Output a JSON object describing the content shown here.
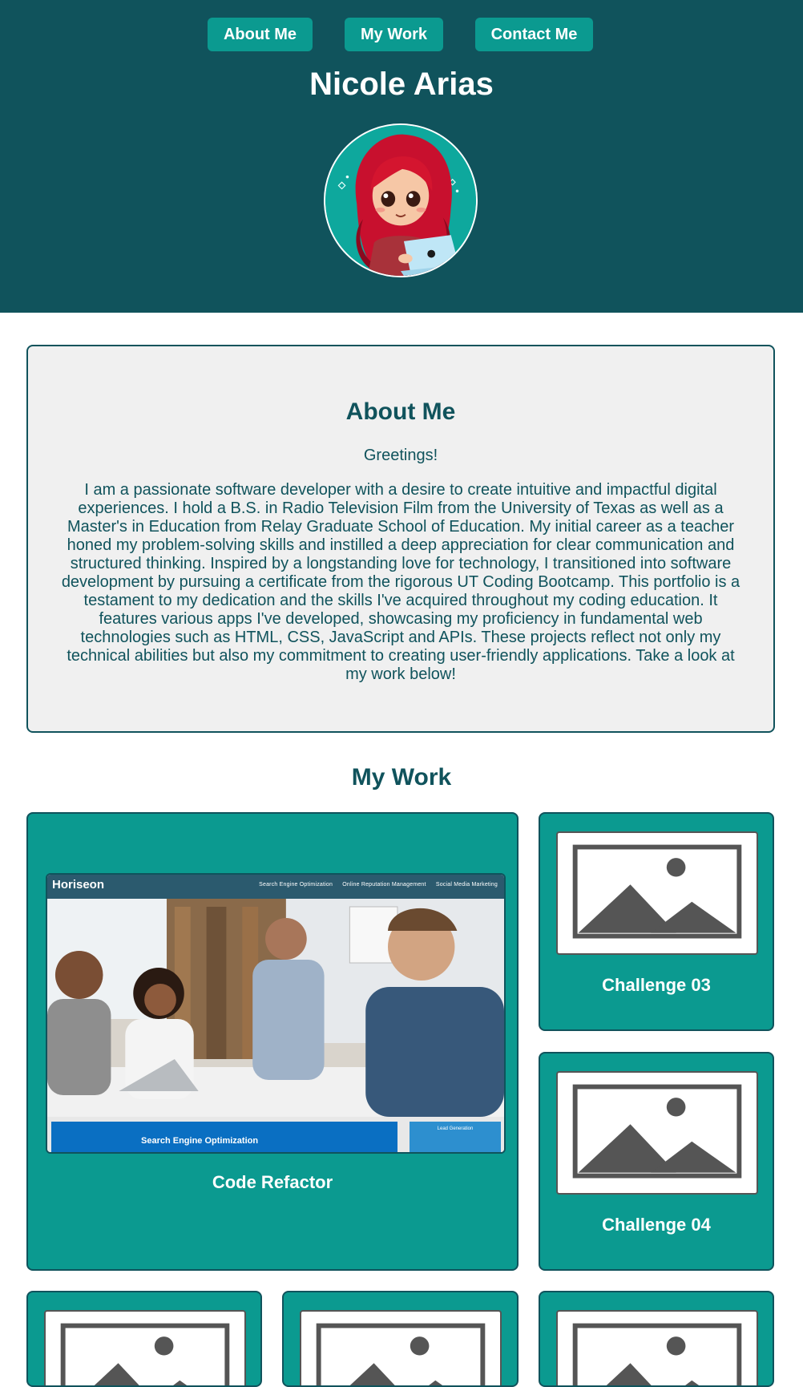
{
  "nav": {
    "about_label": "About Me",
    "work_label": "My Work",
    "contact_label": "Contact Me"
  },
  "header": {
    "title": "Nicole Arias",
    "avatar_icon": "cartoon-avatar-red-hair-laptop"
  },
  "about": {
    "title": "About Me",
    "greeting": "Greetings!",
    "body": "I am a passionate software developer with a desire to create intuitive and impactful digital experiences. I hold a B.S. in Radio Television Film from the University of Texas as well as a Master's in Education from Relay Graduate School of Education. My initial career as a teacher honed my problem-solving skills and instilled a deep appreciation for clear communication and structured thinking. Inspired by a longstanding love for technology, I transitioned into software development by pursuing a certificate from the rigorous UT Coding Bootcamp. This portfolio is a testament to my dedication and the skills I've acquired throughout my coding education. It features various apps I've developed, showcasing my proficiency in fundamental web technologies such as HTML, CSS, JavaScript and APIs. These projects reflect not only my technical abilities but also my commitment to creating user-friendly applications. Take a look at my work below!"
  },
  "work": {
    "title": "My Work",
    "projects": [
      {
        "label": "Code Refactor",
        "screenshot": {
          "brand": "Horiseon",
          "nav": [
            "Search Engine Optimization",
            "Online Reputation Management",
            "Social Media Marketing"
          ],
          "section": "Search Engine Optimization",
          "side": "Lead Generation"
        }
      },
      {
        "label": "Challenge 03"
      },
      {
        "label": "Challenge 04"
      }
    ]
  },
  "colors": {
    "header_bg": "#10535c",
    "accent": "#0b9a90",
    "card_border": "#10535c",
    "about_bg": "#f0f0f0"
  }
}
